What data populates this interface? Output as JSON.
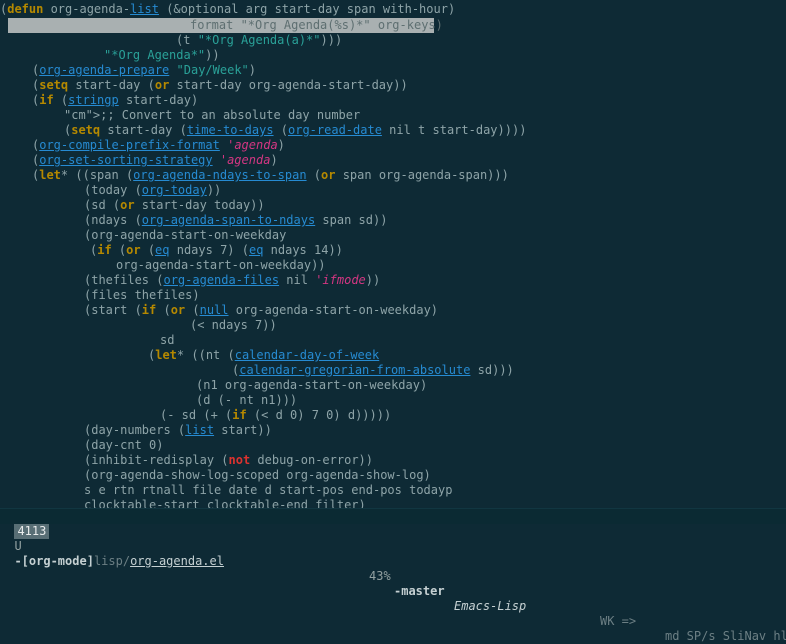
{
  "editor": {
    "highlight_text": "format \"*Org Agenda(%s)*\" org-keys)",
    "lines": [
      "(defun org-agenda-list (&optional arg start-day span with-hour)",
      "(t \"*Org Agenda(a)*\")))",
      "\"*Org Agenda*\"))",
      "(org-agenda-prepare \"Day/Week\")",
      "(setq start-day (or start-day org-agenda-start-day))",
      "(if (stringp start-day)",
      ";; Convert to an absolute day number",
      "(setq start-day (time-to-days (org-read-date nil t start-day))))",
      "(org-compile-prefix-format 'agenda)",
      "(org-set-sorting-strategy 'agenda)",
      "(let* ((span (org-agenda-ndays-to-span (or span org-agenda-span)))",
      "(today (org-today))",
      "(sd (or start-day today))",
      "(ndays (org-agenda-span-to-ndays span sd))",
      "(org-agenda-start-on-weekday",
      "(if (or (eq ndays 7) (eq ndays 14))",
      "org-agenda-start-on-weekday))",
      "(thefiles (org-agenda-files nil 'ifmode))",
      "(files thefiles)",
      "(start (if (or (null org-agenda-start-on-weekday)",
      "(< ndays 7))",
      "sd",
      "(let* ((nt (calendar-day-of-week",
      "(calendar-gregorian-from-absolute sd)))",
      "(n1 org-agenda-start-on-weekday)",
      "(d (- nt n1)))",
      "(- sd (+ (if (< d 0) 7 0) d)))))",
      "(day-numbers (list start))",
      "(day-cnt 0)",
      "(inhibit-redisplay (not debug-on-error))",
      "(org-agenda-show-log-scoped org-agenda-show-log)",
      "s e rtn rtnall file date d start-pos end-pos todayp",
      "clocktable-start clocktable-end filter)"
    ]
  },
  "modeline": {
    "line_number": "4113",
    "state": "U",
    "mode": "-[org-mode]",
    "path": "lisp/",
    "file": "org-agenda.el",
    "percent": "43%",
    "branch": "-master",
    "major_mode": "Emacs-Lisp",
    "right": "WK =>",
    "right2": "md SP/s SliNav hl"
  }
}
